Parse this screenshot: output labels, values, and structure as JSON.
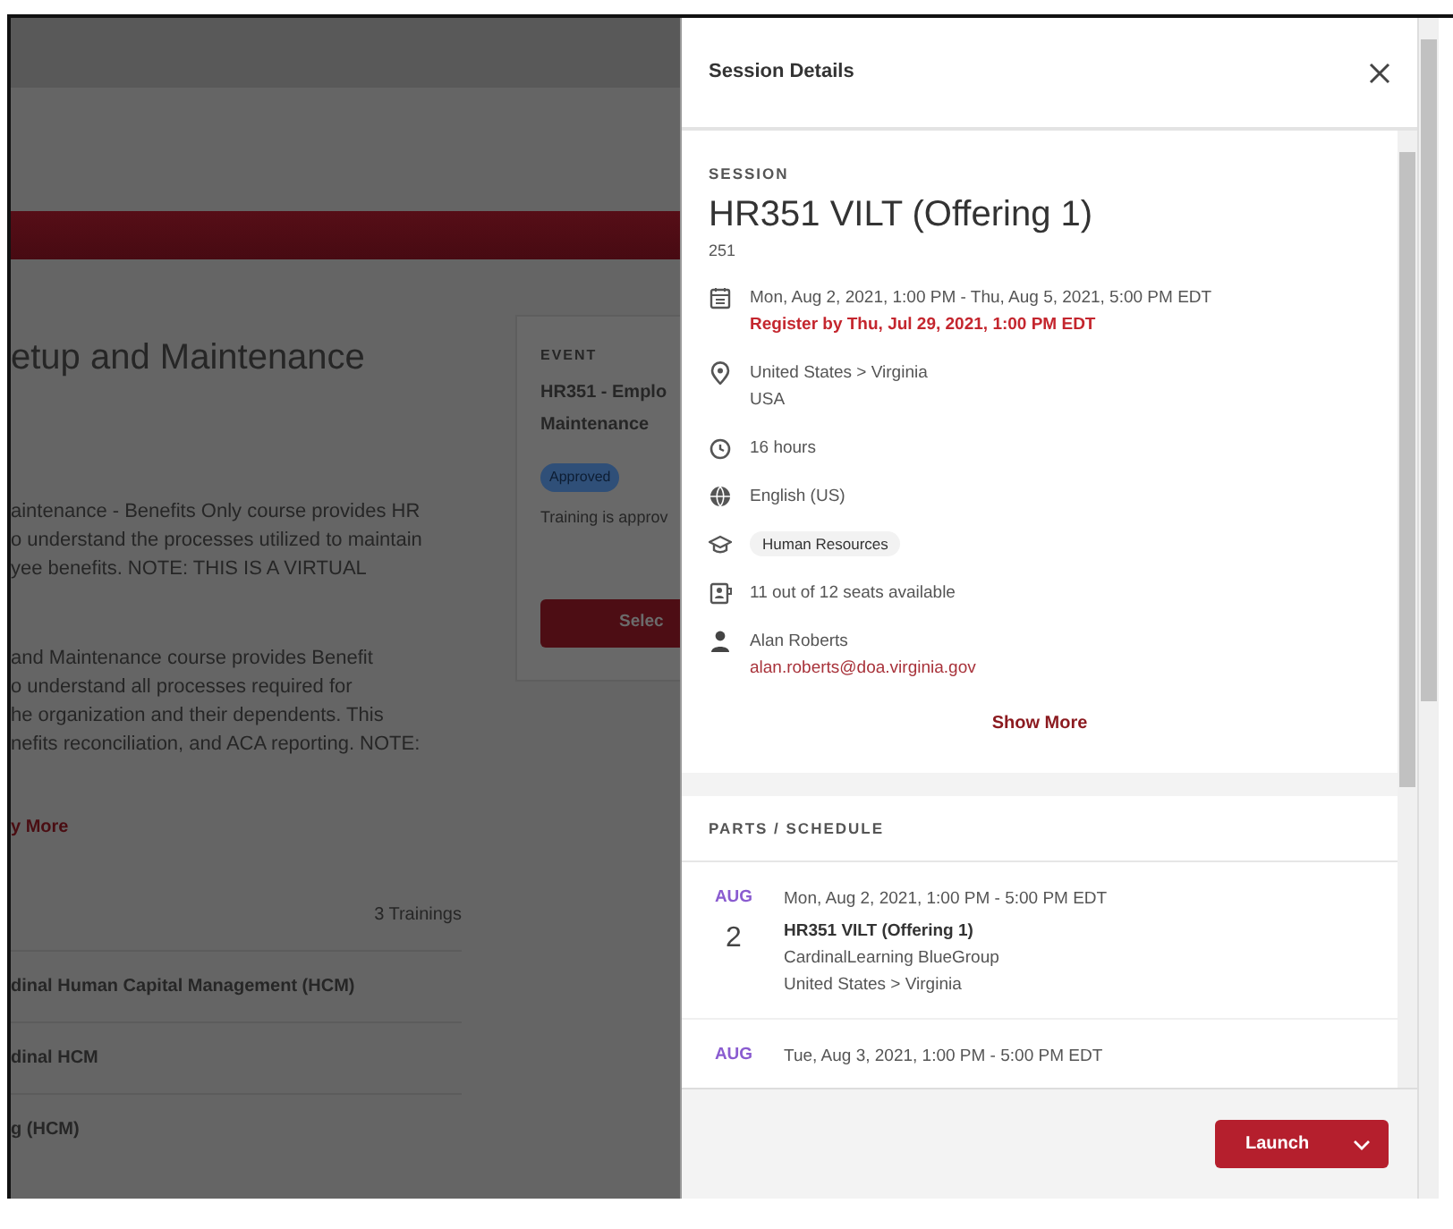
{
  "background_page": {
    "title": "etup and Maintenance",
    "description_1": [
      "aintenance - Benefits Only course provides HR",
      "o understand the processes utilized to maintain",
      "yee benefits. NOTE: THIS IS A VIRTUAL"
    ],
    "description_2": [
      "and Maintenance course provides Benefit",
      "o understand all processes required for",
      "he organization and their dependents. This",
      "nefits reconciliation, and ACA reporting. NOTE:"
    ],
    "show_more": "y More",
    "trainings_count": "3 Trainings",
    "trainings": [
      "dinal Human Capital Management (HCM)",
      "dinal HCM",
      "g (HCM)"
    ],
    "event_card": {
      "label": "EVENT",
      "title_lines": [
        "HR351 - Emplo",
        "Maintenance"
      ],
      "status": "Approved",
      "note": "Training is approv",
      "button": "Selec"
    }
  },
  "panel": {
    "title": "Session Details",
    "session": {
      "label": "SESSION",
      "name": "HR351 VILT (Offering 1)",
      "code": "251",
      "details": [
        {
          "kind": "date",
          "text": "Mon, Aug 2, 2021, 1:00 PM - Thu, Aug 5, 2021, 5:00 PM EDT",
          "deadline": "Register by Thu, Jul 29, 2021, 1:00 PM EDT"
        },
        {
          "kind": "location",
          "text": "United States > Virginia",
          "subtext": "USA"
        },
        {
          "kind": "duration",
          "text": "16 hours"
        },
        {
          "kind": "language",
          "text": "English (US)"
        },
        {
          "kind": "subject",
          "tag": "Human Resources"
        },
        {
          "kind": "seats",
          "text": "11 out of 12 seats available"
        },
        {
          "kind": "contact",
          "text": "Alan Roberts",
          "email": "alan.roberts@doa.virginia.gov"
        }
      ],
      "show_more": "Show More"
    },
    "schedule": {
      "heading": "PARTS / SCHEDULE",
      "items": [
        {
          "month": "AUG",
          "day": "2",
          "time": "Mon, Aug 2, 2021, 1:00 PM - 5:00 PM EDT",
          "title": "HR351 VILT (Offering 1)",
          "group": "CardinalLearning BlueGroup",
          "location": "United States > Virginia"
        },
        {
          "month": "AUG",
          "time": "Tue, Aug 3, 2021, 1:00 PM - 5:00 PM EDT"
        }
      ]
    },
    "footer": {
      "button": "Launch"
    }
  }
}
